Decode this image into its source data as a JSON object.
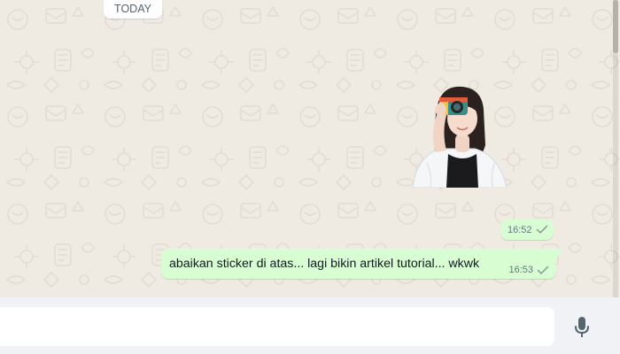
{
  "chat": {
    "date_divider": "TODAY",
    "sticker_message": {
      "time": "16:52",
      "status_icon": "single-check-icon"
    },
    "text_message": {
      "text": "abaikan sticker di atas... lagi bikin artikel tutorial... wkwk",
      "time": "16:53",
      "status_icon": "single-check-icon"
    }
  },
  "composer": {
    "placeholder": "",
    "mic_icon": "microphone-icon"
  },
  "colors": {
    "chat_background": "#efeae2",
    "outgoing_bubble": "#d9fdd3",
    "footer_background": "#f0f2f5",
    "meta_text": "#667781",
    "icon": "#54656f"
  }
}
